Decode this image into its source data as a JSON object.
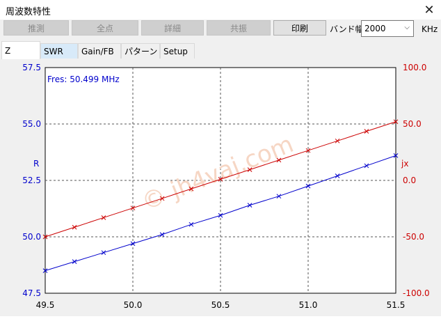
{
  "window": {
    "title": "周波数特性",
    "close_icon": "close-icon"
  },
  "toolbar": {
    "buttons": [
      {
        "label": "推測",
        "enabled": false
      },
      {
        "label": "全点",
        "enabled": false
      },
      {
        "label": "詳細",
        "enabled": false
      },
      {
        "label": "共振",
        "enabled": false
      },
      {
        "label": "印刷",
        "enabled": true
      }
    ],
    "band_label": "バンド幅",
    "band_value": "2000",
    "unit": "KHz"
  },
  "tabs": [
    {
      "label": "Z",
      "active": true
    },
    {
      "label": "SWR",
      "active": false
    },
    {
      "label": "Gain/FB",
      "active": false
    },
    {
      "label": "パターン",
      "active": false
    },
    {
      "label": "Setup",
      "active": false
    }
  ],
  "chart_data": {
    "type": "line",
    "annotation": "Fres: 50.499 MHz",
    "watermark": "© jh4vaj.com",
    "left_axis_label": "R",
    "right_axis_label": "jx",
    "x": [
      49.5,
      49.667,
      49.833,
      50.0,
      50.167,
      50.333,
      50.5,
      50.667,
      50.833,
      51.0,
      51.167,
      51.333,
      51.5
    ],
    "xlim": [
      49.5,
      51.5
    ],
    "x_ticks": [
      "49.5",
      "50.0",
      "50.5",
      "51.0",
      "51.5"
    ],
    "ylim_left": [
      47.5,
      57.5
    ],
    "y_ticks_left": [
      "57.5",
      "55.0",
      "52.5",
      "50.0",
      "47.5"
    ],
    "ylim_right": [
      -100,
      100
    ],
    "y_ticks_right": [
      "100.0",
      "50.0",
      "0.0",
      "-50.0",
      "-100.0"
    ],
    "grid": true,
    "series": [
      {
        "axis": "left",
        "color": "#0000cc",
        "values": [
          48.5,
          48.9,
          49.3,
          49.7,
          50.1,
          50.55,
          50.95,
          51.4,
          51.8,
          52.25,
          52.7,
          53.15,
          53.6
        ]
      },
      {
        "axis": "right",
        "color": "#cc0000",
        "values": [
          -50,
          -41.5,
          -33,
          -24.5,
          -16,
          -7.5,
          1,
          9.5,
          18,
          26.5,
          35,
          43.5,
          52
        ]
      }
    ]
  }
}
